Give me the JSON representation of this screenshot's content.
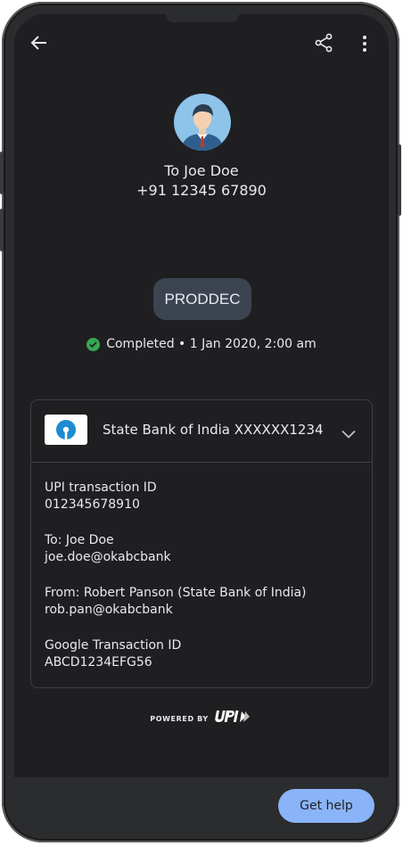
{
  "header": {
    "back_icon": "arrow-left-icon",
    "share_icon": "share-icon",
    "more_icon": "more-vert-icon"
  },
  "recipient": {
    "title": "To Joe Doe",
    "phone": "+91 12345 67890",
    "avatar_icon": "person-avatar-icon"
  },
  "note": "PRODDEC",
  "status": {
    "text": "Completed • 1 Jan 2020, 2:00 am",
    "icon": "check-circle-icon",
    "color": "#34a853"
  },
  "card": {
    "bank_logo_icon": "sbi-logo-icon",
    "bank_account": "State Bank of India XXXXXX1234",
    "expand_icon": "chevron-down-icon",
    "upi_id_label": "UPI transaction ID",
    "upi_id_value": "012345678910",
    "to_label": "To: Joe Doe",
    "to_value": "joe.doe@okabcbank",
    "from_label": "From: Robert Panson  (State Bank of India)",
    "from_value": "rob.pan@okabcbank",
    "google_id_label": "Google Transaction ID",
    "google_id_value": "ABCD1234EFG56"
  },
  "footer": {
    "powered_by": "POWERED BY",
    "upi_logo_icon": "upi-logo-icon"
  },
  "bottom": {
    "help_label": "Get help"
  },
  "colors": {
    "background": "#1f1f21",
    "accent": "#8ab4f8",
    "note_pill": "#3c4452"
  }
}
